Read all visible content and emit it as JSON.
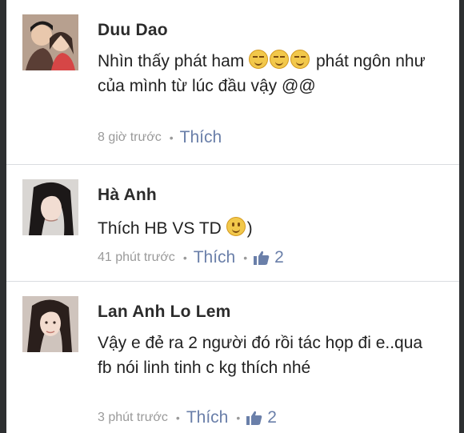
{
  "comments": [
    {
      "name": "Duu Dao",
      "text_before": "Nhìn thấy phát ham",
      "emojis": [
        "smirk-emoji",
        "smirk-emoji",
        "smirk-emoji"
      ],
      "text_after": "phát ngôn như của mình từ lúc đầu vậy @@",
      "time": "8 giờ trước",
      "like_label": "Thích"
    },
    {
      "name": "Hà Anh",
      "text_before": "Thích HB VS TD",
      "emojis": [
        "smile-emoji"
      ],
      "text_after": ")",
      "time": "41 phút trước",
      "like_label": "Thích",
      "likes": "2"
    },
    {
      "name": "Lan Anh Lo Lem",
      "text_before": "Vậy e đẻ ra 2 người đó rồi tác họp đi e..qua fb nói linh tinh c kg thích nhé",
      "text_after": "",
      "time": "3 phút trước",
      "like_label": "Thích",
      "likes": "2"
    }
  ],
  "meta_separator": "•",
  "colors": {
    "like_blue": "#6a7fa9",
    "meta_gray": "#9a9a9a",
    "name": "#2b2b2b"
  },
  "icons": {
    "like": "thumbs-up-icon"
  }
}
